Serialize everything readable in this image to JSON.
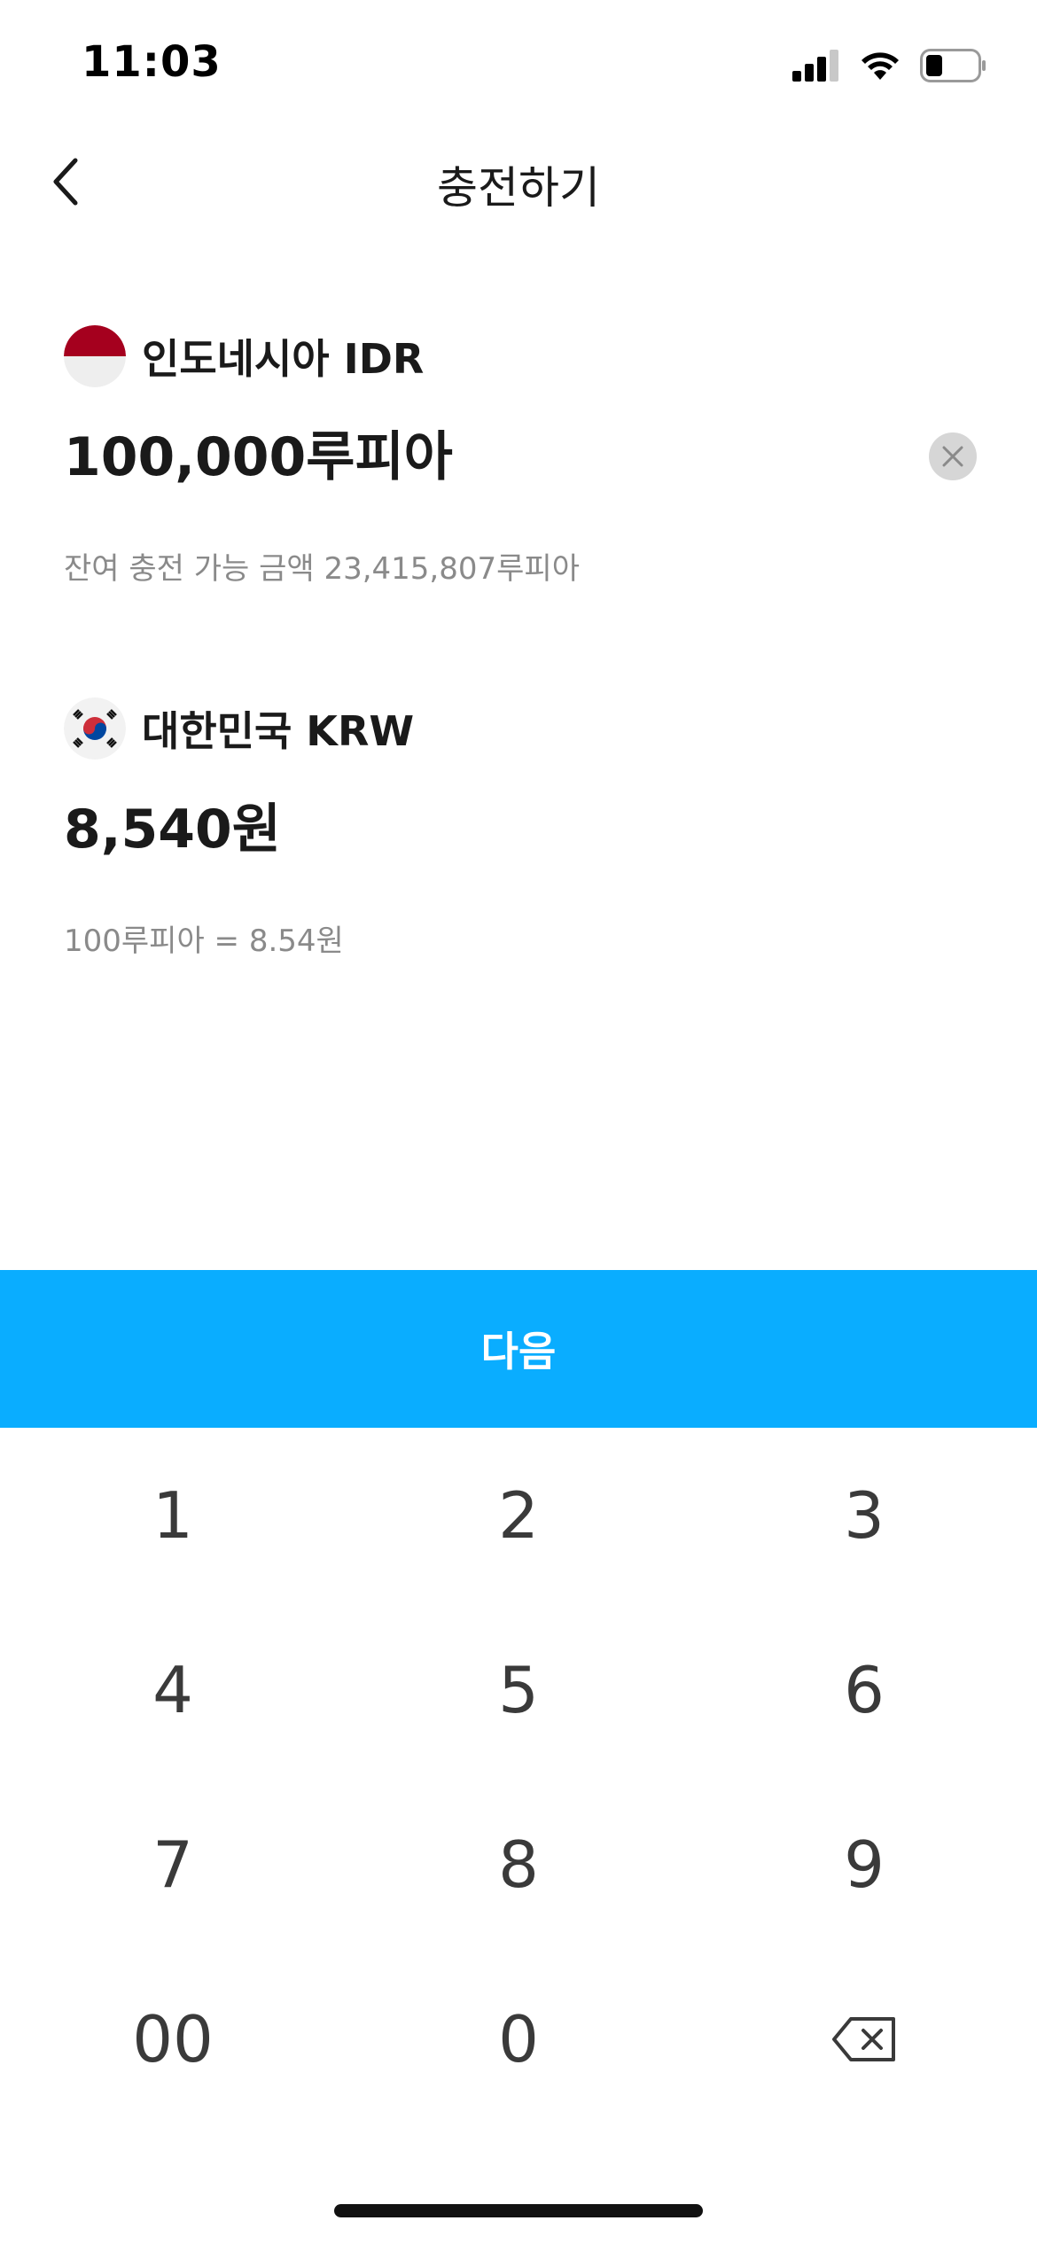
{
  "status_bar": {
    "time": "11:03"
  },
  "header": {
    "title": "충전하기"
  },
  "source_currency": {
    "name": "인도네시아 IDR",
    "amount": "100,000루피아",
    "helper": "잔여 충전 가능 금액 23,415,807루피아",
    "flag": "indonesia-flag-icon"
  },
  "target_currency": {
    "name": "대한민국 KRW",
    "amount": "8,540원",
    "rate": "100루피아 = 8.54원",
    "flag": "korea-flag-icon"
  },
  "next_button": {
    "label": "다음",
    "color": "#0aadff"
  },
  "keypad": {
    "keys": [
      "1",
      "2",
      "3",
      "4",
      "5",
      "6",
      "7",
      "8",
      "9",
      "00",
      "0"
    ],
    "backspace_icon": "backspace-icon"
  }
}
